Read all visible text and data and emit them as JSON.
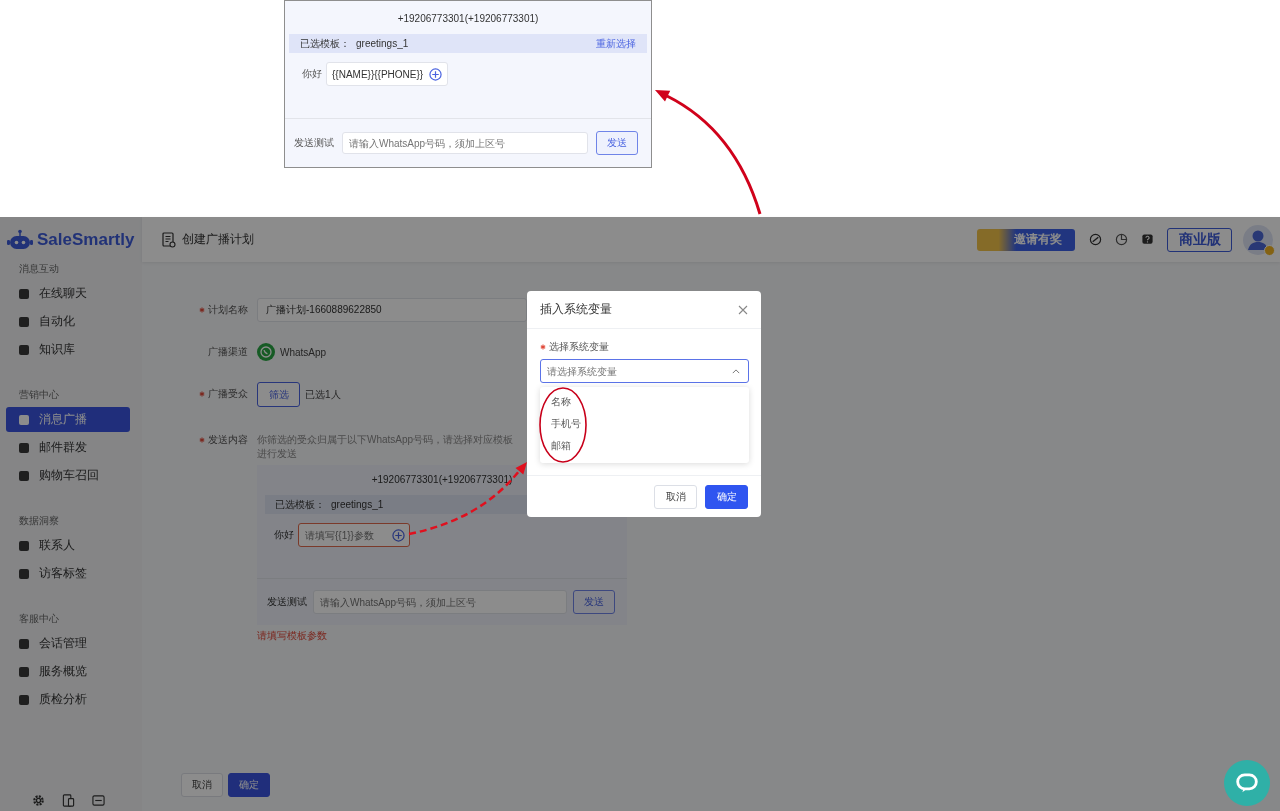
{
  "inset": {
    "number_title": "+19206773301(+19206773301)",
    "template_label": "已选模板：",
    "template_name": "greetings_1",
    "reselect_link": "重新选择",
    "greeting_label": "你好",
    "param_value": "{{NAME}}{{PHONE}}",
    "test_label": "发送测试",
    "test_placeholder": "请输入WhatsApp号码，须加上区号",
    "send_button": "发送"
  },
  "app": {
    "logo": "SaleSmartly",
    "page_title": "创建广播计划",
    "invite_banner": "邀请有奖",
    "plan_button": "商业版",
    "sidebar": [
      {
        "title": "消息互动",
        "items": [
          {
            "label": "在线聊天",
            "selected": false
          },
          {
            "label": "自动化",
            "selected": false
          },
          {
            "label": "知识库",
            "selected": false
          }
        ]
      },
      {
        "title": "营销中心",
        "items": [
          {
            "label": "消息广播",
            "selected": true
          },
          {
            "label": "邮件群发",
            "selected": false
          },
          {
            "label": "购物车召回",
            "selected": false
          }
        ]
      },
      {
        "title": "数据洞察",
        "items": [
          {
            "label": "联系人",
            "selected": false
          },
          {
            "label": "访客标签",
            "selected": false
          }
        ]
      },
      {
        "title": "客服中心",
        "items": [
          {
            "label": "会话管理",
            "selected": false
          },
          {
            "label": "服务概览",
            "selected": false
          },
          {
            "label": "质检分析",
            "selected": false
          }
        ]
      }
    ],
    "form": {
      "fields": [
        {
          "kind": "input",
          "label": "计划名称",
          "required": true,
          "value": "广播计划-1660889622850"
        },
        {
          "kind": "channel",
          "label": "广播渠道",
          "required": false,
          "value": "WhatsApp"
        },
        {
          "kind": "audience",
          "label": "广播受众",
          "required": true,
          "button": "筛选",
          "value": "已选1人"
        },
        {
          "kind": "content",
          "label": "发送内容",
          "required": true,
          "hint": "你筛选的受众归属于以下WhatsApp号码，请选择对应模板进行发送"
        }
      ],
      "content_panel": {
        "number_title": "+19206773301(+19206773301)",
        "template_label": "已选模板：",
        "template_name": "greetings_1",
        "greeting_label": "你好",
        "param_placeholder": "请填写{{1}}参数",
        "param_error": true,
        "test_label": "发送测试",
        "test_placeholder": "请输入WhatsApp号码，须加上区号",
        "send_button": "发送",
        "error_text": "请填写模板参数"
      },
      "cancel_button": "取消",
      "confirm_button": "确定"
    },
    "dialog": {
      "title": "插入系统变量",
      "field_label": "选择系统变量",
      "required": true,
      "placeholder": "请选择系统变量",
      "expanded": true,
      "options": [
        "名称",
        "手机号",
        "邮箱"
      ],
      "cancel_button": "取消",
      "confirm_button": "确定"
    }
  }
}
